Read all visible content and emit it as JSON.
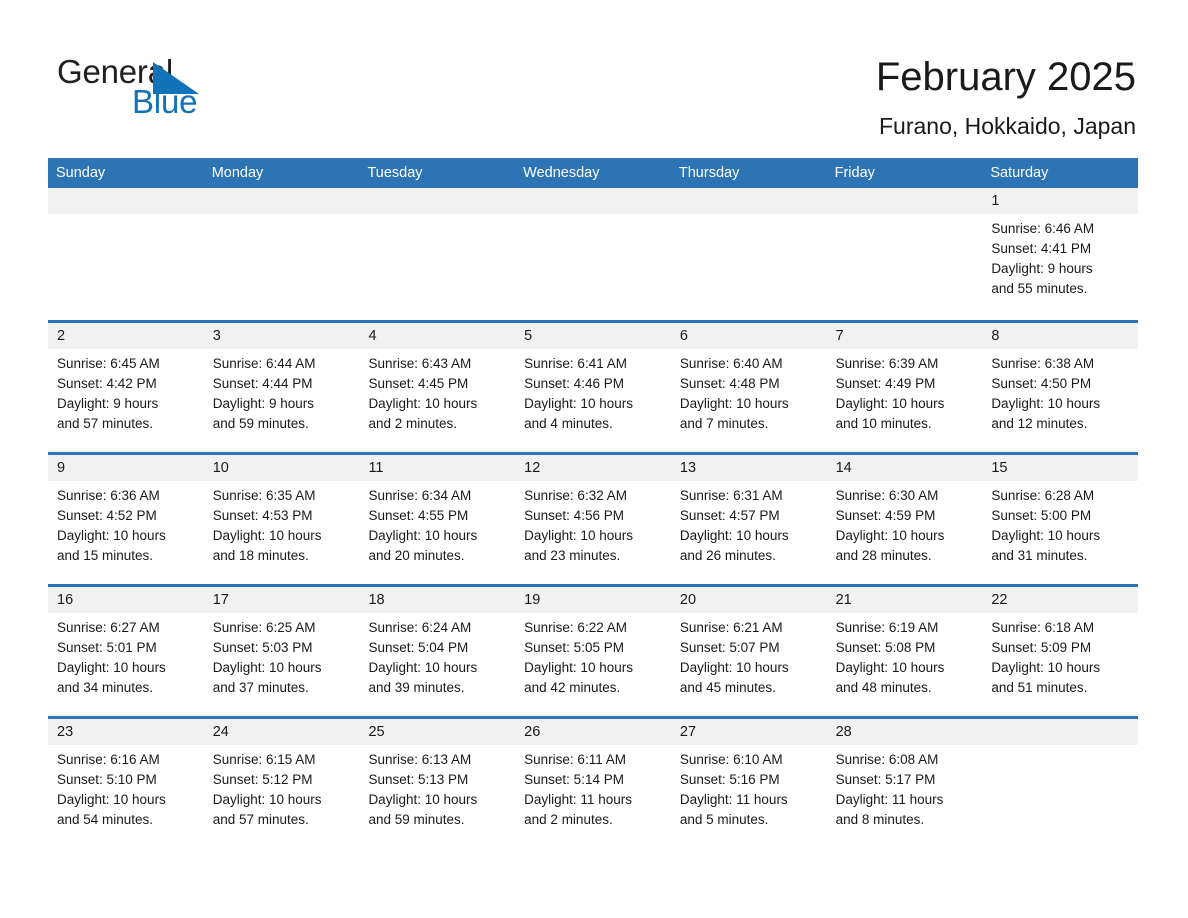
{
  "brand": {
    "name_part1": "General",
    "name_part2": "Blue",
    "triangle_color": "#1272b8",
    "icon": "triangle-logo-icon"
  },
  "header": {
    "title": "February 2025",
    "subtitle": "Furano, Hokkaido, Japan"
  },
  "theme": {
    "header_blue": "#2c74b3",
    "daynum_band": "#f1f1f1",
    "text": "#1a1a1a",
    "brand_blue": "#1272b8"
  },
  "weekdays": [
    "Sunday",
    "Monday",
    "Tuesday",
    "Wednesday",
    "Thursday",
    "Friday",
    "Saturday"
  ],
  "weeks": [
    [
      {
        "empty": true
      },
      {
        "empty": true
      },
      {
        "empty": true
      },
      {
        "empty": true
      },
      {
        "empty": true
      },
      {
        "empty": true
      },
      {
        "day": "1",
        "sunrise": "Sunrise: 6:46 AM",
        "sunset": "Sunset: 4:41 PM",
        "daylight1": "Daylight: 9 hours",
        "daylight2": "and 55 minutes."
      }
    ],
    [
      {
        "day": "2",
        "sunrise": "Sunrise: 6:45 AM",
        "sunset": "Sunset: 4:42 PM",
        "daylight1": "Daylight: 9 hours",
        "daylight2": "and 57 minutes."
      },
      {
        "day": "3",
        "sunrise": "Sunrise: 6:44 AM",
        "sunset": "Sunset: 4:44 PM",
        "daylight1": "Daylight: 9 hours",
        "daylight2": "and 59 minutes."
      },
      {
        "day": "4",
        "sunrise": "Sunrise: 6:43 AM",
        "sunset": "Sunset: 4:45 PM",
        "daylight1": "Daylight: 10 hours",
        "daylight2": "and 2 minutes."
      },
      {
        "day": "5",
        "sunrise": "Sunrise: 6:41 AM",
        "sunset": "Sunset: 4:46 PM",
        "daylight1": "Daylight: 10 hours",
        "daylight2": "and 4 minutes."
      },
      {
        "day": "6",
        "sunrise": "Sunrise: 6:40 AM",
        "sunset": "Sunset: 4:48 PM",
        "daylight1": "Daylight: 10 hours",
        "daylight2": "and 7 minutes."
      },
      {
        "day": "7",
        "sunrise": "Sunrise: 6:39 AM",
        "sunset": "Sunset: 4:49 PM",
        "daylight1": "Daylight: 10 hours",
        "daylight2": "and 10 minutes."
      },
      {
        "day": "8",
        "sunrise": "Sunrise: 6:38 AM",
        "sunset": "Sunset: 4:50 PM",
        "daylight1": "Daylight: 10 hours",
        "daylight2": "and 12 minutes."
      }
    ],
    [
      {
        "day": "9",
        "sunrise": "Sunrise: 6:36 AM",
        "sunset": "Sunset: 4:52 PM",
        "daylight1": "Daylight: 10 hours",
        "daylight2": "and 15 minutes."
      },
      {
        "day": "10",
        "sunrise": "Sunrise: 6:35 AM",
        "sunset": "Sunset: 4:53 PM",
        "daylight1": "Daylight: 10 hours",
        "daylight2": "and 18 minutes."
      },
      {
        "day": "11",
        "sunrise": "Sunrise: 6:34 AM",
        "sunset": "Sunset: 4:55 PM",
        "daylight1": "Daylight: 10 hours",
        "daylight2": "and 20 minutes."
      },
      {
        "day": "12",
        "sunrise": "Sunrise: 6:32 AM",
        "sunset": "Sunset: 4:56 PM",
        "daylight1": "Daylight: 10 hours",
        "daylight2": "and 23 minutes."
      },
      {
        "day": "13",
        "sunrise": "Sunrise: 6:31 AM",
        "sunset": "Sunset: 4:57 PM",
        "daylight1": "Daylight: 10 hours",
        "daylight2": "and 26 minutes."
      },
      {
        "day": "14",
        "sunrise": "Sunrise: 6:30 AM",
        "sunset": "Sunset: 4:59 PM",
        "daylight1": "Daylight: 10 hours",
        "daylight2": "and 28 minutes."
      },
      {
        "day": "15",
        "sunrise": "Sunrise: 6:28 AM",
        "sunset": "Sunset: 5:00 PM",
        "daylight1": "Daylight: 10 hours",
        "daylight2": "and 31 minutes."
      }
    ],
    [
      {
        "day": "16",
        "sunrise": "Sunrise: 6:27 AM",
        "sunset": "Sunset: 5:01 PM",
        "daylight1": "Daylight: 10 hours",
        "daylight2": "and 34 minutes."
      },
      {
        "day": "17",
        "sunrise": "Sunrise: 6:25 AM",
        "sunset": "Sunset: 5:03 PM",
        "daylight1": "Daylight: 10 hours",
        "daylight2": "and 37 minutes."
      },
      {
        "day": "18",
        "sunrise": "Sunrise: 6:24 AM",
        "sunset": "Sunset: 5:04 PM",
        "daylight1": "Daylight: 10 hours",
        "daylight2": "and 39 minutes."
      },
      {
        "day": "19",
        "sunrise": "Sunrise: 6:22 AM",
        "sunset": "Sunset: 5:05 PM",
        "daylight1": "Daylight: 10 hours",
        "daylight2": "and 42 minutes."
      },
      {
        "day": "20",
        "sunrise": "Sunrise: 6:21 AM",
        "sunset": "Sunset: 5:07 PM",
        "daylight1": "Daylight: 10 hours",
        "daylight2": "and 45 minutes."
      },
      {
        "day": "21",
        "sunrise": "Sunrise: 6:19 AM",
        "sunset": "Sunset: 5:08 PM",
        "daylight1": "Daylight: 10 hours",
        "daylight2": "and 48 minutes."
      },
      {
        "day": "22",
        "sunrise": "Sunrise: 6:18 AM",
        "sunset": "Sunset: 5:09 PM",
        "daylight1": "Daylight: 10 hours",
        "daylight2": "and 51 minutes."
      }
    ],
    [
      {
        "day": "23",
        "sunrise": "Sunrise: 6:16 AM",
        "sunset": "Sunset: 5:10 PM",
        "daylight1": "Daylight: 10 hours",
        "daylight2": "and 54 minutes."
      },
      {
        "day": "24",
        "sunrise": "Sunrise: 6:15 AM",
        "sunset": "Sunset: 5:12 PM",
        "daylight1": "Daylight: 10 hours",
        "daylight2": "and 57 minutes."
      },
      {
        "day": "25",
        "sunrise": "Sunrise: 6:13 AM",
        "sunset": "Sunset: 5:13 PM",
        "daylight1": "Daylight: 10 hours",
        "daylight2": "and 59 minutes."
      },
      {
        "day": "26",
        "sunrise": "Sunrise: 6:11 AM",
        "sunset": "Sunset: 5:14 PM",
        "daylight1": "Daylight: 11 hours",
        "daylight2": "and 2 minutes."
      },
      {
        "day": "27",
        "sunrise": "Sunrise: 6:10 AM",
        "sunset": "Sunset: 5:16 PM",
        "daylight1": "Daylight: 11 hours",
        "daylight2": "and 5 minutes."
      },
      {
        "day": "28",
        "sunrise": "Sunrise: 6:08 AM",
        "sunset": "Sunset: 5:17 PM",
        "daylight1": "Daylight: 11 hours",
        "daylight2": "and 8 minutes."
      },
      {
        "empty": true
      }
    ]
  ]
}
